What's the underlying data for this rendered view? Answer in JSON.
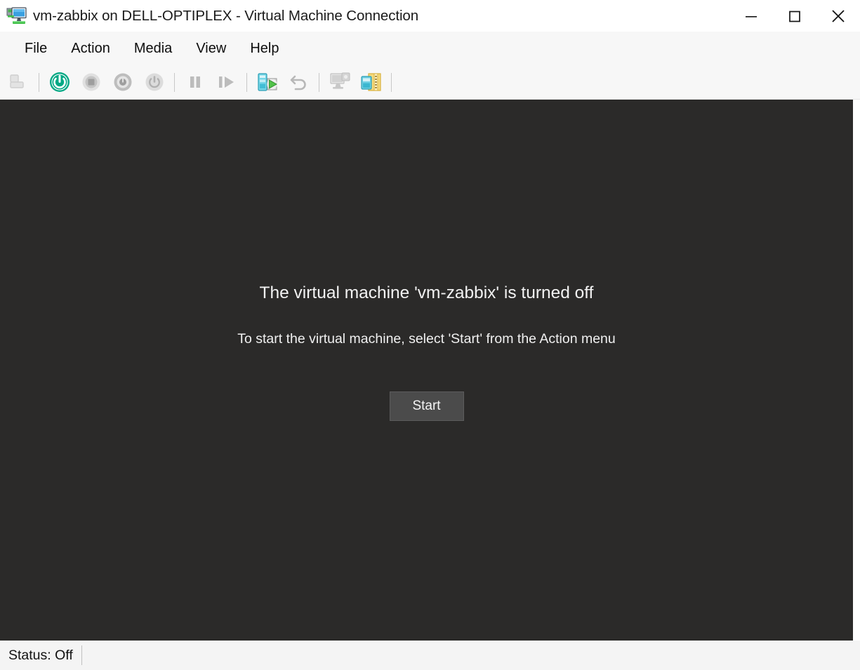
{
  "window": {
    "title": "vm-zabbix on DELL-OPTIPLEX - Virtual Machine Connection",
    "icon": "virtual-machine-icon",
    "controls": {
      "minimize": "minimize-icon",
      "maximize": "maximize-icon",
      "close": "close-icon"
    }
  },
  "menubar": {
    "items": [
      {
        "label": "File"
      },
      {
        "label": "Action"
      },
      {
        "label": "Media"
      },
      {
        "label": "View"
      },
      {
        "label": "Help"
      }
    ]
  },
  "toolbar": {
    "buttons": [
      {
        "name": "ctrl-alt-del-icon",
        "enabled": false
      },
      {
        "name": "separator-1",
        "type": "separator"
      },
      {
        "name": "start-power-icon",
        "enabled": true
      },
      {
        "name": "turn-off-icon",
        "enabled": false
      },
      {
        "name": "shut-down-icon",
        "enabled": false
      },
      {
        "name": "save-state-icon",
        "enabled": false
      },
      {
        "name": "separator-2",
        "type": "separator"
      },
      {
        "name": "pause-icon",
        "enabled": false
      },
      {
        "name": "reset-icon",
        "enabled": false
      },
      {
        "name": "separator-3",
        "type": "separator"
      },
      {
        "name": "checkpoint-icon",
        "enabled": true
      },
      {
        "name": "revert-icon",
        "enabled": false
      },
      {
        "name": "separator-4",
        "type": "separator"
      },
      {
        "name": "settings-icon",
        "enabled": false
      },
      {
        "name": "enhanced-session-icon",
        "enabled": true
      },
      {
        "name": "separator-5",
        "type": "separator"
      }
    ]
  },
  "vm_screen": {
    "message_main": "The virtual machine 'vm-zabbix' is turned off",
    "message_sub": "To start the virtual machine, select 'Start' from the Action menu",
    "start_button_label": "Start",
    "background_color": "#2b2a29"
  },
  "statusbar": {
    "status": "Status: Off"
  },
  "colors": {
    "accent_green": "#00a884",
    "title_text": "#1a1a1a",
    "chrome": "#f7f7f7",
    "vm_background": "#2b2a29"
  }
}
